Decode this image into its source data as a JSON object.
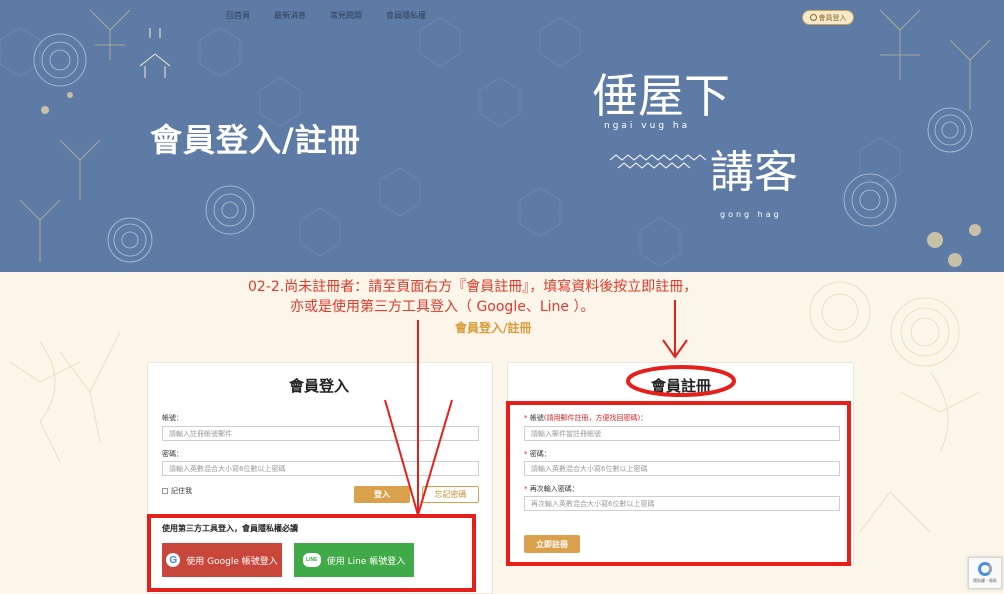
{
  "nav": {
    "items": [
      "回首頁",
      "最新消息",
      "常見問題",
      "會員隱私權"
    ],
    "login_label": "會員登入"
  },
  "hero": {
    "title": "會員登入/註冊",
    "logo_line1": "倕屋下",
    "logo_romanized1": "ngai vug ha",
    "logo_line2": "講客",
    "logo_romanized2": "gong hag"
  },
  "instructions": {
    "line1": "02-2.尚未註冊者：請至頁面右方『會員註冊』，填寫資料後按立即註冊，",
    "line2": "亦或是使用第三方工具登入（ Google、Line ）。",
    "subtitle": "會員登入/註冊"
  },
  "login": {
    "heading": "會員登入",
    "account_label": "帳號：",
    "account_placeholder": "請輸入註冊帳號郵件",
    "password_label": "密碼：",
    "password_placeholder": "請輸入英數混合大小寫6位數以上密碼",
    "remember_label": "記住我",
    "login_button": "登入",
    "forgot_button": "忘記密碼",
    "third_party_title": "使用第三方工具登入，會員隱私權必讀",
    "google_button": "使用 Google 帳號登入",
    "line_button": "使用 Line 帳號登入"
  },
  "register": {
    "heading": "會員註冊",
    "account_label": "帳號",
    "account_hint": "(請用郵件註冊，方便找回密碼)",
    "account_label_suffix": "：",
    "account_placeholder": "請輸入郵件當註冊帳號",
    "password_label": "密碼：",
    "password_placeholder": "請輸入英數混合大小寫6位數以上密碼",
    "confirm_label": "再次輸入密碼：",
    "confirm_placeholder": "再次輸入英數混合大小寫6位數以上密碼",
    "required_mark": "*",
    "submit_button": "立即註冊"
  },
  "recaptcha": {
    "text": "隱私權 - 條款"
  },
  "colors": {
    "hero_bg": "#5e7ba6",
    "page_bg": "#fbf5ea",
    "accent_gold": "#d9a14c",
    "annotation_red": "#e5201b",
    "google_red": "#c9473a",
    "line_green": "#3faa47"
  }
}
